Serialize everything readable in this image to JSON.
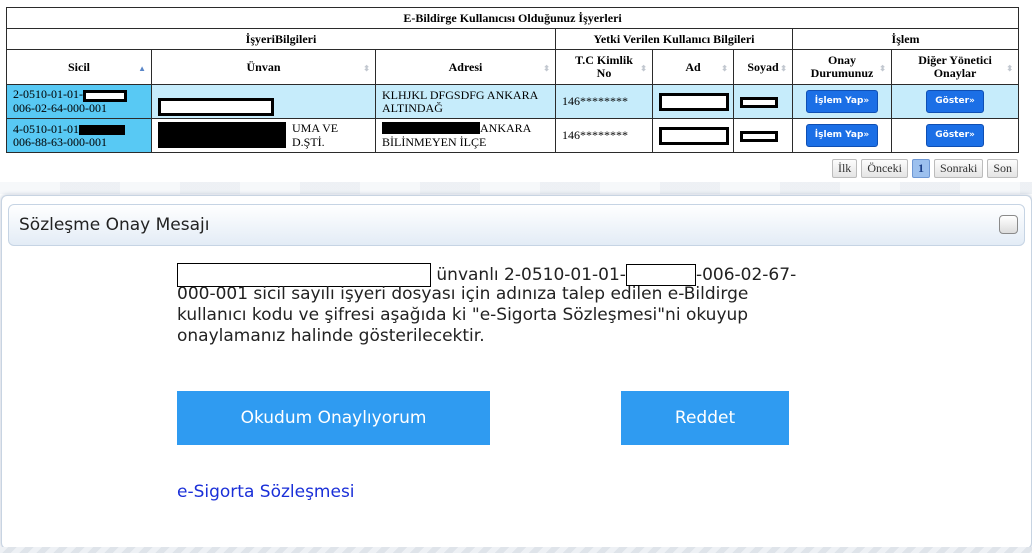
{
  "table": {
    "caption": "E-Bildirge Kullanıcısı Olduğunuz İşyerleri",
    "groups": {
      "isyeri": "İşyeriBilgileri",
      "yetki": "Yetki Verilen Kullanıcı Bilgileri",
      "islem": "İşlem"
    },
    "columns": {
      "sicil": "Sicil",
      "unvan": "Ünvan",
      "adresi": "Adresi",
      "tc_line1": "T.C Kimlik",
      "tc_line2": "No",
      "ad": "Ad",
      "soyad": "Soyad",
      "onay_line1": "Onay",
      "onay_line2": "Durumunuz",
      "diger_line1": "Diğer Yönetici",
      "diger_line2": "Onaylar"
    },
    "rows": [
      {
        "sicil_line1": "2-0510-01-01-",
        "sicil_line2": "006-02-64-000-001",
        "unvan_suffix_1": "",
        "unvan_suffix_2": "",
        "adresi_line1": "KLHJKL DFGSDFG ANKARA",
        "adresi_line2": "ALTINDAĞ",
        "tc": "146********",
        "onay_btn": "İşlem Yap»",
        "diger_btn": "Göster»"
      },
      {
        "sicil_line1": "4-0510-01-01",
        "sicil_line2": "006-88-63-000-001",
        "unvan_suffix_1": "UMA VE",
        "unvan_suffix_2": "D.ŞTİ.",
        "adresi_line1": "ANKARA",
        "adresi_line2": "BİLİNMEYEN İLÇE",
        "tc": "146********",
        "onay_btn": "İşlem Yap»",
        "diger_btn": "Göster»"
      }
    ]
  },
  "pager": {
    "first": "İlk",
    "prev": "Önceki",
    "current": "1",
    "next": "Sonraki",
    "last": "Son"
  },
  "modal": {
    "title": "Sözleşme Onay Mesajı",
    "message": {
      "part1": "ünvanlı 2-0510-01-01-",
      "part2": "-006-02-67-",
      "line2": "000-001 sicil sayılı işyeri dosyası için adınıza talep edilen e-Bildirge",
      "line3": "kullanıcı kodu ve şifresi aşağıda ki \"e-Sigorta Sözleşmesi\"ni okuyup",
      "line4": "onaylamanız halinde gösterilecektir."
    },
    "accept_label": "Okudum Onaylıyorum",
    "reject_label": "Reddet",
    "link_label": "e-Sigorta Sözleşmesi"
  },
  "colors": {
    "button_blue": "#2f9bf1",
    "row_highlight": "#c6ecfb",
    "sicil_cell": "#58c9f4",
    "action_button": "#1b6fe6",
    "link": "#1a2fd8"
  }
}
